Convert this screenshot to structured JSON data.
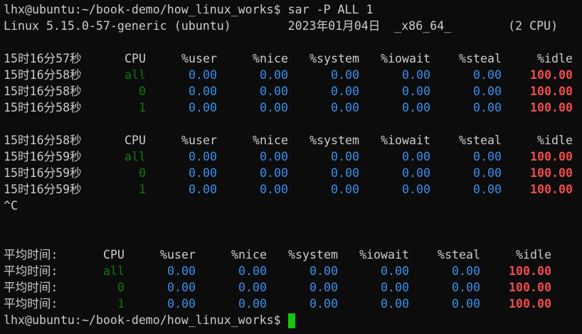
{
  "terminal": {
    "command_line": "lhx@ubuntu:~/book-demo/how_linux_works$ sar -P ALL 1",
    "system_info": "Linux 5.15.0-57-generic (ubuntu)        2023年01月04日  _x86_64_        (2 CPU)",
    "interrupt": "^C",
    "final_prompt": "lhx@ubuntu:~/book-demo/how_linux_works$ ",
    "columns": [
      "CPU",
      "%user",
      "%nice",
      "%system",
      "%iowait",
      "%steal",
      "%idle"
    ],
    "sections": [
      {
        "header_time": "15时16分57秒",
        "rows": [
          {
            "time": "15时16分58秒",
            "values": [
              "all",
              "0.00",
              "0.00",
              "0.00",
              "0.00",
              "0.00",
              "100.00"
            ]
          },
          {
            "time": "15时16分58秒",
            "values": [
              "0",
              "0.00",
              "0.00",
              "0.00",
              "0.00",
              "0.00",
              "100.00"
            ]
          },
          {
            "time": "15时16分58秒",
            "values": [
              "1",
              "0.00",
              "0.00",
              "0.00",
              "0.00",
              "0.00",
              "100.00"
            ]
          }
        ]
      },
      {
        "header_time": "15时16分58秒",
        "rows": [
          {
            "time": "15时16分59秒",
            "values": [
              "all",
              "0.00",
              "0.00",
              "0.00",
              "0.00",
              "0.00",
              "100.00"
            ]
          },
          {
            "time": "15时16分59秒",
            "values": [
              "0",
              "0.00",
              "0.00",
              "0.00",
              "0.00",
              "0.00",
              "100.00"
            ]
          },
          {
            "time": "15时16分59秒",
            "values": [
              "1",
              "0.00",
              "0.00",
              "0.00",
              "0.00",
              "0.00",
              "100.00"
            ]
          }
        ]
      },
      {
        "header_time": "平均时间:",
        "rows": [
          {
            "time": "平均时间:",
            "values": [
              "all",
              "0.00",
              "0.00",
              "0.00",
              "0.00",
              "0.00",
              "100.00"
            ]
          },
          {
            "time": "平均时间:",
            "values": [
              "0",
              "0.00",
              "0.00",
              "0.00",
              "0.00",
              "0.00",
              "100.00"
            ]
          },
          {
            "time": "平均时间:",
            "values": [
              "1",
              "0.00",
              "0.00",
              "0.00",
              "0.00",
              "0.00",
              "100.00"
            ]
          }
        ]
      }
    ],
    "colors": {
      "cpu_id": "#13a10e",
      "value": "#3b8eea",
      "idle": "#f14c4c",
      "cursor": "#16c60c"
    }
  }
}
